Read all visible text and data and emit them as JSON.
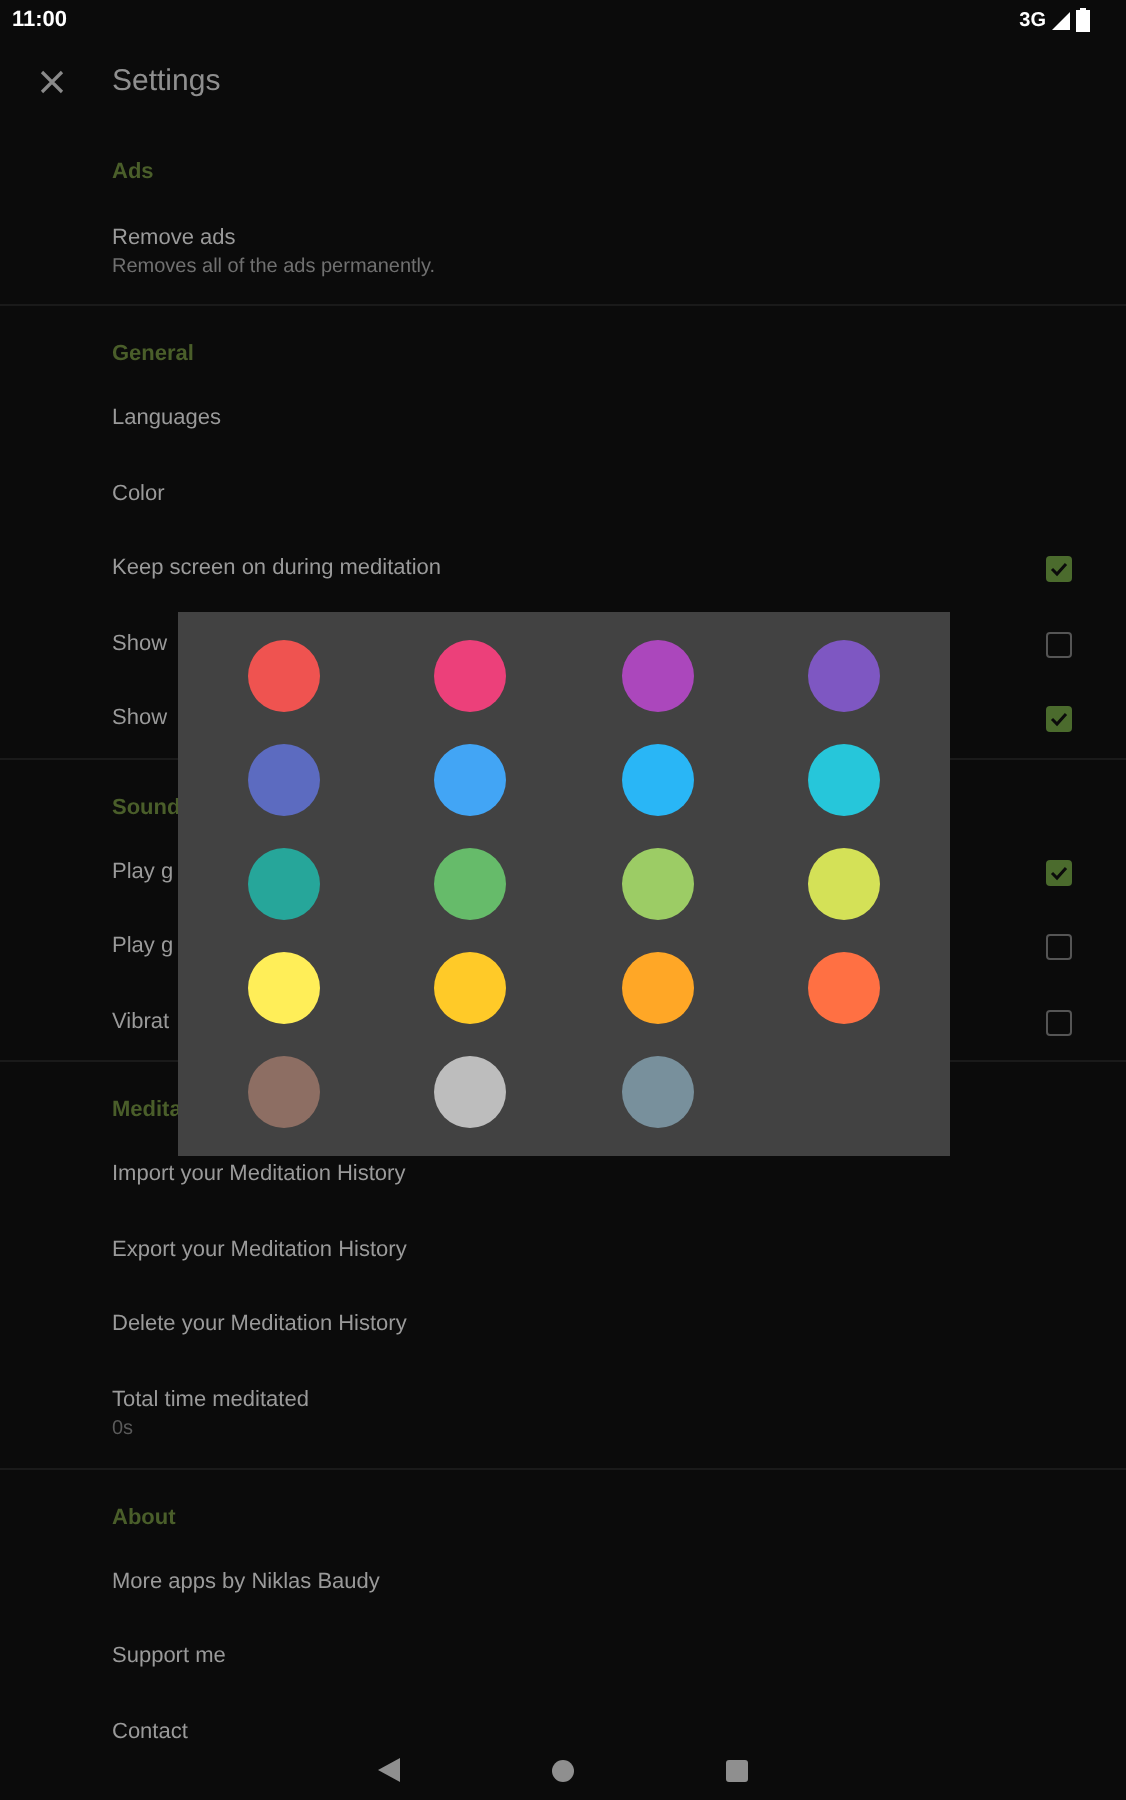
{
  "status_bar": {
    "time": "11:00",
    "network": "3G"
  },
  "toolbar": {
    "title": "Settings"
  },
  "sections": [
    {
      "header": "Ads",
      "items": [
        {
          "kind": "two_line",
          "title": "Remove ads",
          "summary": "Removes all of the ads permanently."
        }
      ]
    },
    {
      "header": "General",
      "items": [
        {
          "kind": "plain",
          "title": "Languages"
        },
        {
          "kind": "plain",
          "title": "Color"
        },
        {
          "kind": "checkbox",
          "title": "Keep screen on during meditation",
          "checked": true
        },
        {
          "kind": "checkbox",
          "title": "Show",
          "checked": false
        },
        {
          "kind": "checkbox",
          "title": "Show",
          "checked": true
        }
      ]
    },
    {
      "header": "Sound",
      "items": [
        {
          "kind": "checkbox",
          "title": "Play g",
          "checked": true
        },
        {
          "kind": "checkbox",
          "title": "Play g",
          "checked": false
        },
        {
          "kind": "checkbox",
          "title": "Vibrat",
          "checked": false
        }
      ]
    },
    {
      "header": "Medita",
      "items": [
        {
          "kind": "plain",
          "title": "Import your Meditation History"
        },
        {
          "kind": "plain",
          "title": "Export your Meditation History"
        },
        {
          "kind": "plain",
          "title": "Delete your Meditation History"
        },
        {
          "kind": "two_line",
          "title": "Total time meditated",
          "summary": "0s"
        }
      ]
    },
    {
      "header": "About",
      "items": [
        {
          "kind": "plain",
          "title": "More apps by Niklas Baudy"
        },
        {
          "kind": "plain",
          "title": "Support me"
        },
        {
          "kind": "plain",
          "title": "Contact"
        }
      ]
    }
  ],
  "color_dialog": {
    "swatches": [
      {
        "color": "#ef5350"
      },
      {
        "color": "#ec407a"
      },
      {
        "color": "#ab47bc"
      },
      {
        "color": "#7e57c2"
      },
      {
        "color": "#5c6bc0"
      },
      {
        "color": "#42a5f5"
      },
      {
        "color": "#29b6f6"
      },
      {
        "color": "#26c6da"
      },
      {
        "color": "#26a69a"
      },
      {
        "color": "#66bb6a"
      },
      {
        "color": "#9ccc65"
      },
      {
        "color": "#d4e157"
      },
      {
        "color": "#ffee58"
      },
      {
        "color": "#ffca28"
      },
      {
        "color": "#ffa726"
      },
      {
        "color": "#ff7043"
      },
      {
        "color": "#8d6e63"
      },
      {
        "color": "#bdbdbd"
      },
      {
        "color": "#78909c"
      }
    ]
  }
}
